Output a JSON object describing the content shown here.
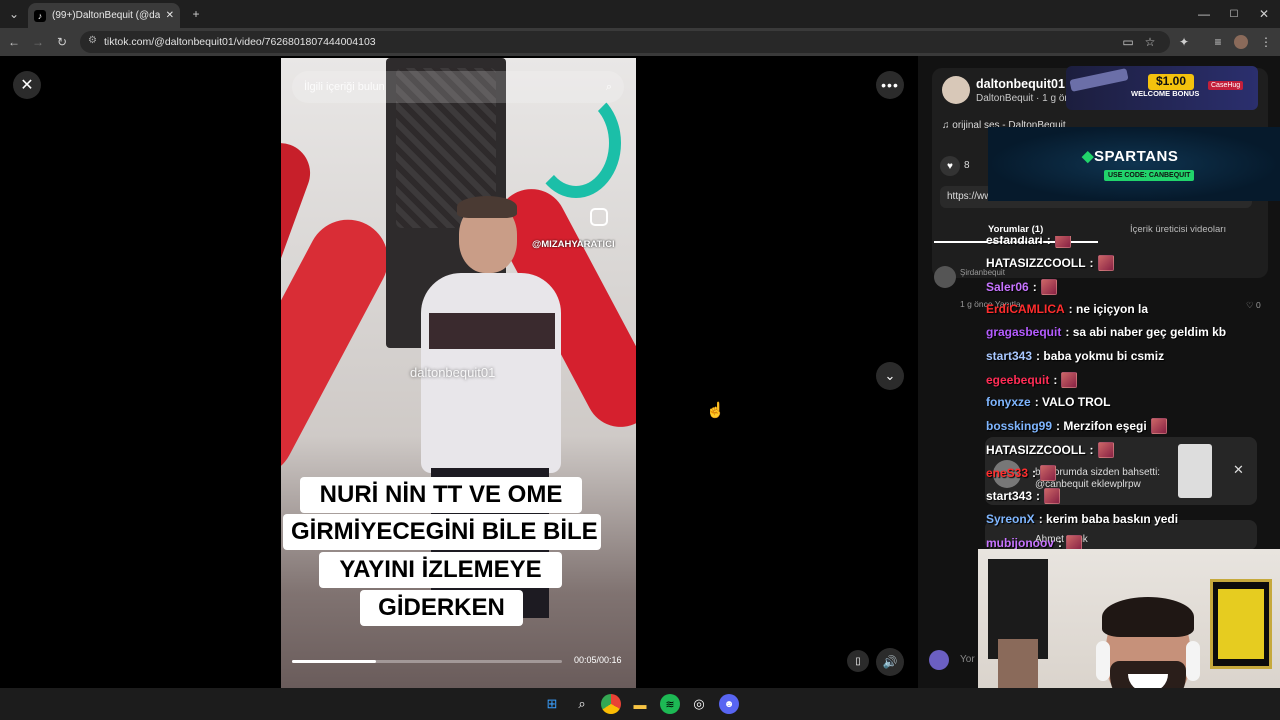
{
  "browser": {
    "tab_title": "(99+)DaltonBequit (@dalto...",
    "tab_close": "✕",
    "new_tab": "+",
    "url": "tiktok.com/@daltonbequit01/video/7626801807444004103",
    "win_min": "—",
    "win_max": "☐",
    "win_close": "✕"
  },
  "video": {
    "search_placeholder": "İlgili içeriği bulun",
    "insta_handle": "@MIZAHYARATICI",
    "watermark": "daltonbequit01",
    "caption_line1": "NURİ NİN TT VE OME",
    "caption_line2": "GİRMİYECEGİNİ BİLE BİLE",
    "caption_line3": "YAYINI İZLEMEYE",
    "caption_line4": "GİDERKEN",
    "time": "00:05/00:16",
    "progress": 0.31
  },
  "panel": {
    "username": "daltonbequit01",
    "subline": "DaltonBequit · 1 g önce",
    "music": "♫  orijinal ses - DaltonBequit",
    "like_count": "8",
    "link": "https://www.tiktok.com/@daltonbequit01/video/7626801807444004103",
    "tab_comments": "Yorumlar (1)",
    "tab_creator": "İçerik üreticisi videoları",
    "comment_user": "Şirdanbequit",
    "comment_time": "1 g önce    Yanıtla",
    "comment_likes": "♡ 0",
    "input_placeholder": "Yor"
  },
  "ads": {
    "amount": "$1.00",
    "bonus": "WELCOME BONUS",
    "brand": "CaseHug",
    "spartans": "SPARTANS",
    "code": "USE CODE: CANBEQUIT"
  },
  "chat": [
    {
      "user": "esfandiari",
      "color": "#ffffff",
      "text": " :",
      "emote": true
    },
    {
      "user": "HATASIZZCOOLL",
      "color": "#ffffff",
      "text": " :",
      "emote": true
    },
    {
      "user": "Saler06",
      "color": "#c774ff",
      "text": " :",
      "emote": true
    },
    {
      "user": "ErdiCAMLICA",
      "color": "#ff2d2d",
      "text": " : ne içiçyon la",
      "emote": false
    },
    {
      "user": "gragasbequit",
      "color": "#b45cff",
      "text": " : sa abi naber geç geldim kb",
      "emote": false
    },
    {
      "user": "start343",
      "color": "#a9c8ff",
      "text": " : baba yokmu bi csmiz",
      "emote": false
    },
    {
      "user": "egeebequit",
      "color": "#ff2d55",
      "text": " :",
      "emote": true
    },
    {
      "user": "fonyxze",
      "color": "#7fb6ff",
      "text": " : VALO TROL",
      "emote": false
    },
    {
      "user": "bossking99",
      "color": "#7fb6ff",
      "text": " : Merzifon eşegi",
      "emote": true
    },
    {
      "user": "HATASIZZCOOLL",
      "color": "#ffffff",
      "text": " :",
      "emote": true
    },
    {
      "user": "eneS33",
      "color": "#ff2d2d",
      "text": " :",
      "emote": true
    },
    {
      "user": "start343",
      "color": "#ffffff",
      "text": " :",
      "emote": true
    },
    {
      "user": "SyreonX",
      "color": "#7fb6ff",
      "text": " : kerim baba baskın yedi",
      "emote": false
    },
    {
      "user": "mubijonoov",
      "color": "#c774ff",
      "text": " :",
      "emote": true
    }
  ],
  "notification": {
    "text": "bir yorumda sizden bahsetti: @canbequit eklewplrpw",
    "close": "✕",
    "second": "Ahmet çenk"
  },
  "colors": {
    "accent": "#fe2c55",
    "chrome_bg": "#3a3a3a"
  }
}
